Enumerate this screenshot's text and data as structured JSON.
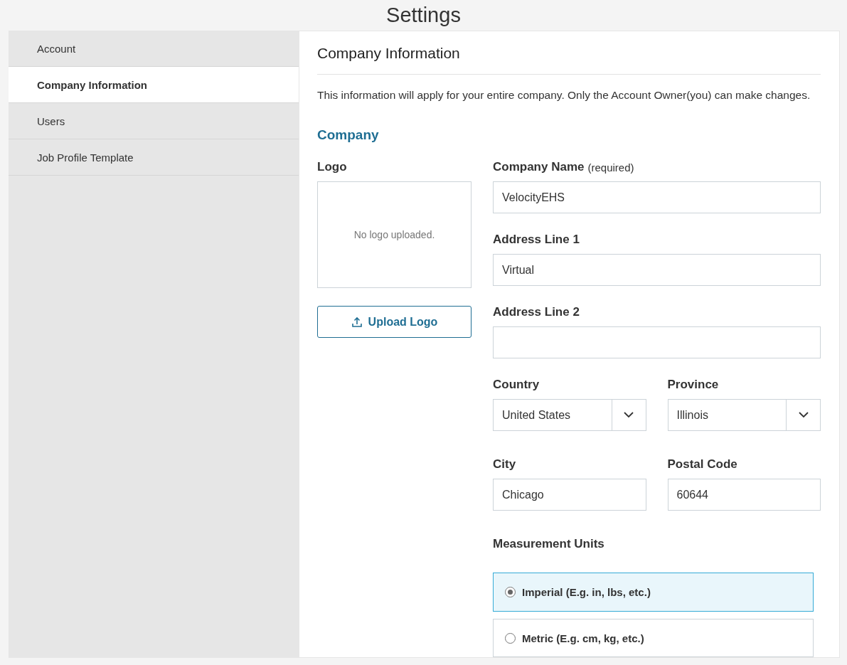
{
  "page_title": "Settings",
  "sidebar": {
    "items": [
      {
        "label": "Account",
        "selected": false
      },
      {
        "label": "Company Information",
        "selected": true
      },
      {
        "label": "Users",
        "selected": false
      },
      {
        "label": "Job Profile Template",
        "selected": false
      }
    ]
  },
  "panel": {
    "title": "Company Information",
    "description": "This information will apply for your entire company. Only the Account Owner(you) can make changes.",
    "section_title": "Company",
    "logo": {
      "label": "Logo",
      "empty_text": "No logo uploaded.",
      "upload_button": "Upload Logo"
    },
    "field_rows": [
      [
        {
          "kind": "text",
          "label": "Company Name",
          "hint": "(required)",
          "value": "VelocityEHS"
        }
      ],
      [
        {
          "kind": "text",
          "label": "Address Line 1",
          "value": "Virtual"
        }
      ],
      [
        {
          "kind": "text",
          "label": "Address Line 2"
        }
      ],
      [
        {
          "kind": "select",
          "label": "Country",
          "value": "United States"
        },
        {
          "kind": "select",
          "label": "Province",
          "value": "Illinois"
        }
      ],
      [
        {
          "kind": "text",
          "label": "City",
          "value": "Chicago"
        },
        {
          "kind": "text",
          "label": "Postal Code",
          "value": "60644"
        }
      ]
    ],
    "units": {
      "label": "Measurement Units",
      "options": [
        {
          "label": "Imperial (E.g. in, lbs, etc.)",
          "selected": true
        },
        {
          "label": "Metric (E.g. cm, kg, etc.)",
          "selected": false
        }
      ]
    }
  }
}
